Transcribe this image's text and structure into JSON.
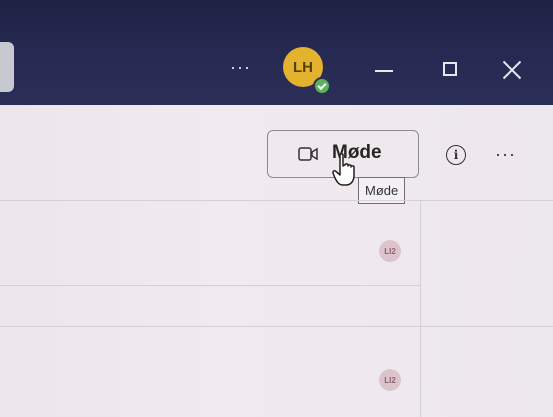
{
  "titlebar": {
    "more_label": "···",
    "avatar_initials": "LH",
    "presence": "available"
  },
  "header": {
    "meet_button_label": "Møde",
    "tooltip": "Møde",
    "more_label": "···",
    "info_symbol": "i"
  },
  "rows": [
    {
      "avatar_initials": "LI2"
    },
    {
      "avatar_initials": "LI2"
    }
  ],
  "colors": {
    "titlebar": "#262a52",
    "avatar": "#e3b22f",
    "presence": "#5bb25a",
    "content": "#efe9ee"
  }
}
